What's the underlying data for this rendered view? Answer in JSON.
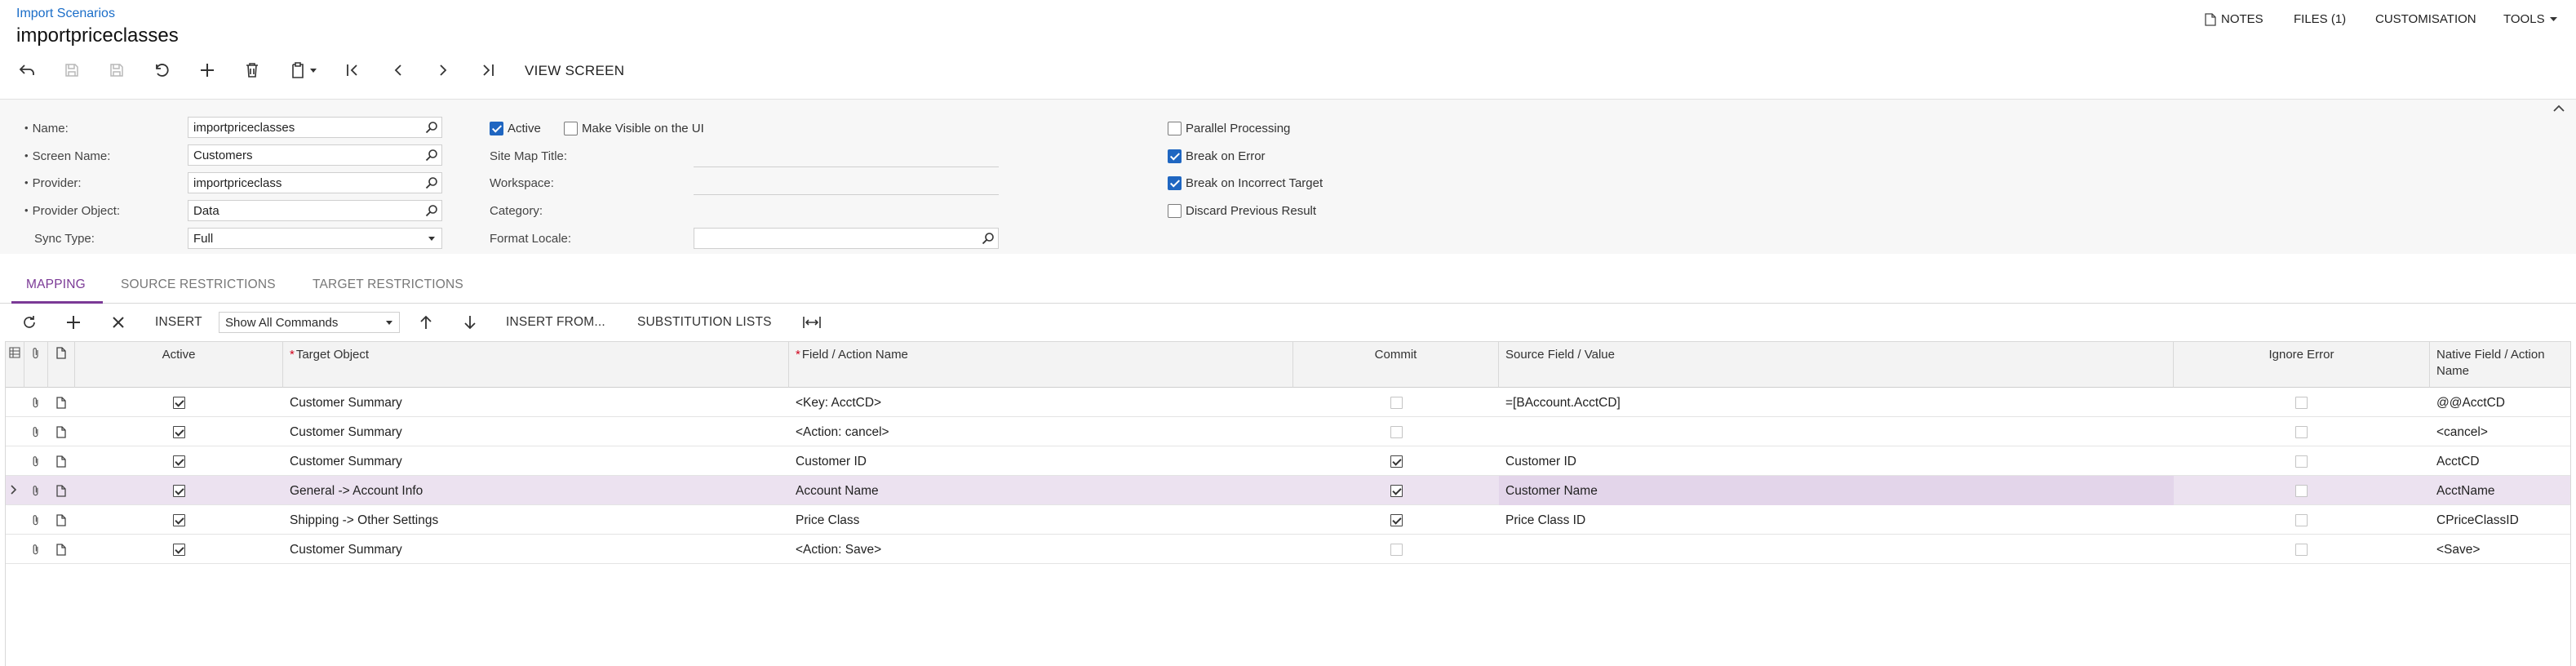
{
  "breadcrumb": "Import Scenarios",
  "title": "importpriceclasses",
  "top_menu": {
    "notes": "NOTES",
    "files": "FILES (1)",
    "customisation": "CUSTOMISATION",
    "tools": "TOOLS"
  },
  "toolbar": {
    "view_screen": "VIEW SCREEN"
  },
  "form": {
    "name_label": "Name:",
    "name_value": "importpriceclasses",
    "screen_name_label": "Screen Name:",
    "screen_name_value": "Customers",
    "provider_label": "Provider:",
    "provider_value": "importpriceclass",
    "provider_object_label": "Provider Object:",
    "provider_object_value": "Data",
    "sync_type_label": "Sync Type:",
    "sync_type_value": "Full",
    "active_label": "Active",
    "active_checked": true,
    "make_visible_label": "Make Visible on the UI",
    "make_visible_checked": false,
    "site_map_title_label": "Site Map Title:",
    "workspace_label": "Workspace:",
    "category_label": "Category:",
    "format_locale_label": "Format Locale:",
    "format_locale_value": "",
    "parallel_processing_label": "Parallel Processing",
    "parallel_processing_checked": false,
    "break_on_error_label": "Break on Error",
    "break_on_error_checked": true,
    "break_on_incorrect_target_label": "Break on Incorrect Target",
    "break_on_incorrect_target_checked": true,
    "discard_previous_result_label": "Discard Previous Result",
    "discard_previous_result_checked": false
  },
  "tabs": [
    {
      "label": "MAPPING",
      "active": true
    },
    {
      "label": "SOURCE RESTRICTIONS",
      "active": false
    },
    {
      "label": "TARGET RESTRICTIONS",
      "active": false
    }
  ],
  "grid_toolbar": {
    "insert": "INSERT",
    "commands_filter": "Show All Commands",
    "insert_from": "INSERT FROM...",
    "substitution_lists": "SUBSTITUTION LISTS"
  },
  "grid": {
    "columns": {
      "active": "Active",
      "target_object": "Target Object",
      "field_action_name": "Field / Action Name",
      "commit": "Commit",
      "source_field_value": "Source Field / Value",
      "ignore_error": "Ignore Error",
      "native_field_action_name": "Native Field / Action Name"
    },
    "rows": [
      {
        "active": true,
        "target_object": "Customer Summary",
        "field_action": "<Key: AcctCD>",
        "commit": false,
        "source": "=[BAccount.AcctCD]",
        "ignore_error": false,
        "native": "@@AcctCD",
        "selected": false
      },
      {
        "active": true,
        "target_object": "Customer Summary",
        "field_action": "<Action: cancel>",
        "commit": false,
        "source": "",
        "ignore_error": false,
        "native": "<cancel>",
        "selected": false
      },
      {
        "active": true,
        "target_object": "Customer Summary",
        "field_action": "Customer ID",
        "commit": true,
        "source": "Customer ID",
        "ignore_error": false,
        "native": "AcctCD",
        "selected": false
      },
      {
        "active": true,
        "target_object": "General -> Account Info",
        "field_action": "Account Name",
        "commit": true,
        "source": "Customer Name",
        "ignore_error": false,
        "native": "AcctName",
        "selected": true
      },
      {
        "active": true,
        "target_object": "Shipping -> Other Settings",
        "field_action": "Price Class",
        "commit": true,
        "source": "Price Class ID",
        "ignore_error": false,
        "native": "CPriceClassID",
        "selected": false
      },
      {
        "active": true,
        "target_object": "Customer Summary",
        "field_action": "<Action: Save>",
        "commit": false,
        "source": "",
        "ignore_error": false,
        "native": "<Save>",
        "selected": false
      }
    ]
  },
  "colors": {
    "accent": "#7b3a96",
    "link": "#1a6dc8",
    "checkbox": "#1f66c1",
    "selected_row": "#ece2f0"
  }
}
